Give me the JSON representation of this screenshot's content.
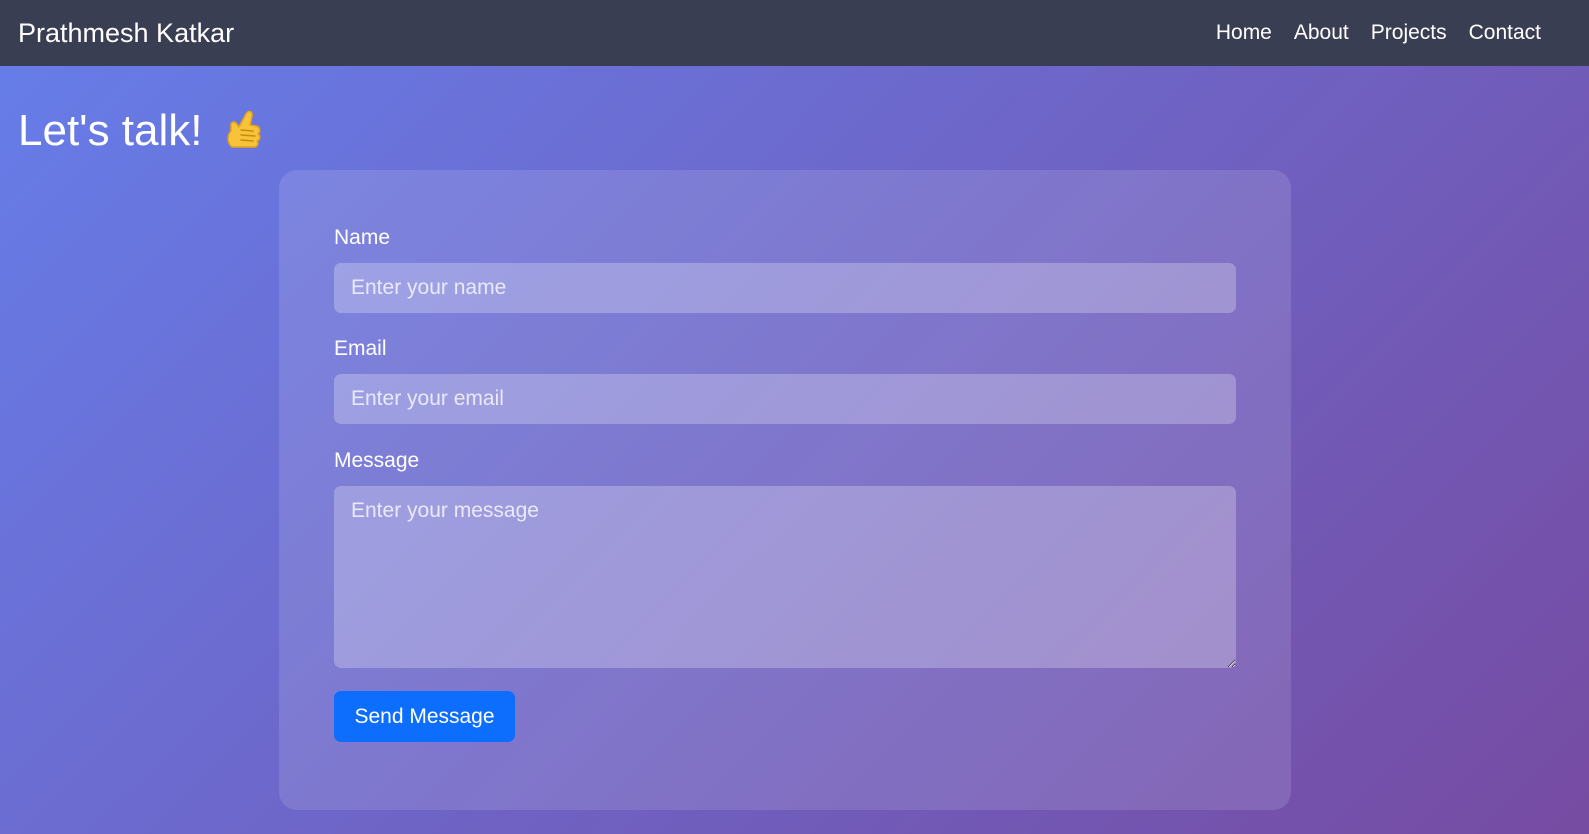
{
  "navbar": {
    "brand": "Prathmesh Katkar",
    "links": [
      "Home",
      "About",
      "Projects",
      "Contact"
    ]
  },
  "page": {
    "heading": "Let's talk!",
    "heading_icon": "call-me-hand-icon"
  },
  "form": {
    "name": {
      "label": "Name",
      "placeholder": "Enter your name",
      "value": ""
    },
    "email": {
      "label": "Email",
      "placeholder": "Enter your email",
      "value": ""
    },
    "message": {
      "label": "Message",
      "placeholder": "Enter your message",
      "value": ""
    },
    "submit_label": "Send Message"
  },
  "colors": {
    "navbar_bg": "#3a3e52",
    "gradient_start": "#667eea",
    "gradient_end": "#764ba2",
    "button_bg": "#0d6efd",
    "emoji_yellow": "#f7c33b"
  }
}
